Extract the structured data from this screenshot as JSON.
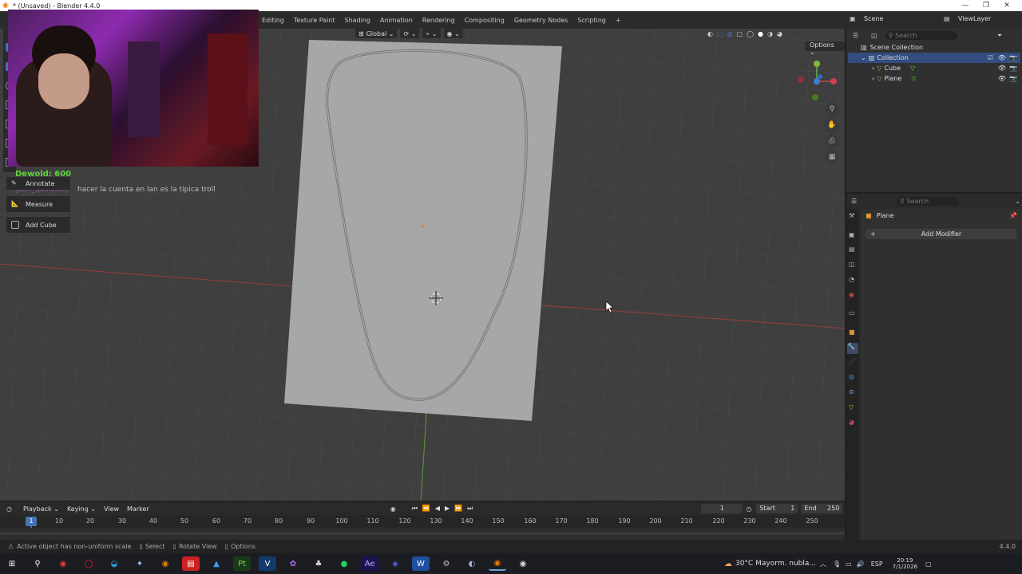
{
  "window": {
    "title": "* (Unsaved) - Blender 4.4.0"
  },
  "workspace_tabs": [
    "Editing",
    "Texture Paint",
    "Shading",
    "Animation",
    "Rendering",
    "Compositing",
    "Geometry Nodes",
    "Scripting",
    "+"
  ],
  "topright": {
    "scene": "Scene",
    "view_layer": "ViewLayer"
  },
  "viewport_header": {
    "transform": "Global",
    "options": "Options"
  },
  "overlay": {
    "donor": "Dewold: 600",
    "chat_user": "juan_quinones",
    "chat_msg": "hacer la cuenta en lan es la tipica troll"
  },
  "tools": [
    {
      "label": "Annotate",
      "icon": "pencil-icon"
    },
    {
      "label": "Measure",
      "icon": "ruler-icon"
    },
    {
      "label": "Add Cube",
      "icon": "cube-icon"
    }
  ],
  "outliner": {
    "search_placeholder": "Search",
    "root": "Scene Collection",
    "collection": "Collection",
    "objects": [
      "Cube",
      "Plane"
    ]
  },
  "properties": {
    "search_placeholder": "Search",
    "object": "Plane",
    "add_modifier": "Add Modifier"
  },
  "timeline": {
    "menus": [
      "Playback",
      "Keying",
      "View",
      "Marker"
    ],
    "current_frame": "1",
    "start_label": "Start",
    "start": "1",
    "end_label": "End",
    "end": "250",
    "ruler": [
      "1",
      "10",
      "20",
      "30",
      "40",
      "50",
      "60",
      "70",
      "80",
      "90",
      "100",
      "110",
      "120",
      "130",
      "140",
      "150",
      "160",
      "170",
      "180",
      "190",
      "200",
      "210",
      "220",
      "230",
      "240",
      "250"
    ]
  },
  "status": {
    "message": "Active object has non-uniform scale",
    "select": "Select",
    "rotate": "Rotate View",
    "options": "Options",
    "version": "4.4.0"
  },
  "taskbar": {
    "weather": "30°C  Mayorm. nubla...",
    "lang": "ESP",
    "time": "20:19",
    "date": "7/1/2026"
  },
  "colors": {
    "accent": "#4772b3",
    "x_axis": "#b04040",
    "y_axis": "#6aa84f"
  }
}
